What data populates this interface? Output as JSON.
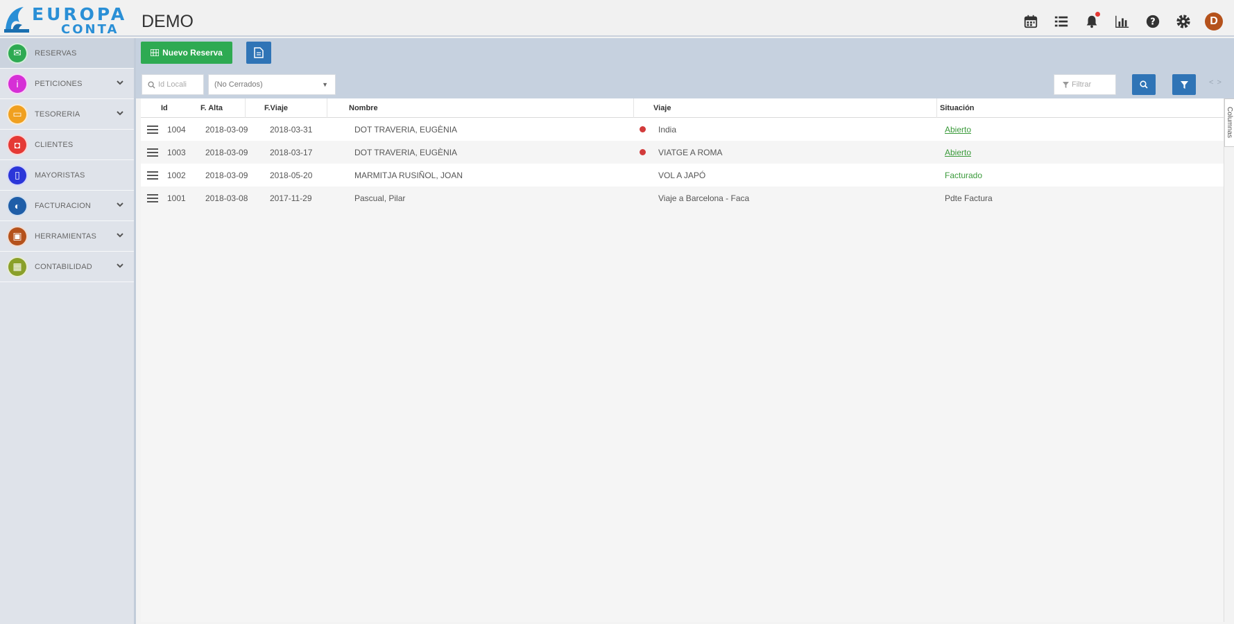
{
  "logo": {
    "line1": "EUROPA",
    "line2": "CONTA"
  },
  "header": {
    "title": "DEMO",
    "avatar_letter": "D",
    "icons": [
      "calendar-icon",
      "list-icon",
      "bell-icon",
      "bar-chart-icon",
      "help-icon",
      "settings-icon"
    ]
  },
  "sidebar": {
    "items": [
      {
        "label": "RESERVAS",
        "color": "#2eaa52",
        "icon": "envelope-icon",
        "has_chevron": false,
        "active": true
      },
      {
        "label": "PETICIONES",
        "color": "#d62fd6",
        "icon": "info-icon",
        "has_chevron": true,
        "active": false
      },
      {
        "label": "TESORERIA",
        "color": "#f0a020",
        "icon": "money-icon",
        "has_chevron": true,
        "active": false
      },
      {
        "label": "CLIENTES",
        "color": "#e53935",
        "icon": "shirt-icon",
        "has_chevron": false,
        "active": false
      },
      {
        "label": "MAYORISTAS",
        "color": "#2b36d9",
        "icon": "book-icon",
        "has_chevron": false,
        "active": false
      },
      {
        "label": "FACTURACION",
        "color": "#1f5ea8",
        "icon": "invoice-icon",
        "has_chevron": true,
        "active": false
      },
      {
        "label": "HERRAMIENTAS",
        "color": "#b5521c",
        "icon": "toolbox-icon",
        "has_chevron": true,
        "active": false
      },
      {
        "label": "CONTABILIDAD",
        "color": "#8aa02a",
        "icon": "calculator-icon",
        "has_chevron": true,
        "active": false
      }
    ]
  },
  "toolbar": {
    "new_label": "Nuevo Reserva"
  },
  "filters": {
    "search_placeholder": "Id Locali",
    "select_value": "(No Cerrados)",
    "filter_placeholder": "Filtrar",
    "collapse_label": "< >"
  },
  "grid": {
    "columns": {
      "id": "Id",
      "alta": "F. Alta",
      "viaje_fecha": "F.Viaje",
      "nombre": "Nombre",
      "viaje": "Viaje",
      "situacion": "Situación"
    },
    "rows": [
      {
        "id": "1004",
        "alta": "2018-03-09",
        "viaje_fecha": "2018-03-31",
        "nombre": "DOT TRAVERIA, EUGÈNIA",
        "flag": true,
        "viaje": "India",
        "situacion": "Abierto",
        "sit_style": "link"
      },
      {
        "id": "1003",
        "alta": "2018-03-09",
        "viaje_fecha": "2018-03-17",
        "nombre": "DOT TRAVERIA, EUGÈNIA",
        "flag": true,
        "viaje": "VIATGE A ROMA",
        "situacion": "Abierto",
        "sit_style": "link"
      },
      {
        "id": "1002",
        "alta": "2018-03-09",
        "viaje_fecha": "2018-05-20",
        "nombre": "MARMITJA RUSIÑOL, JOAN",
        "flag": false,
        "viaje": "VOL A JAPÓ",
        "situacion": "Facturado",
        "sit_style": "green"
      },
      {
        "id": "1001",
        "alta": "2018-03-08",
        "viaje_fecha": "2017-11-29",
        "nombre": "Pascual, Pilar",
        "flag": false,
        "viaje": "Viaje a Barcelona - Faca",
        "situacion": "Pdte Factura",
        "sit_style": "gray"
      }
    ]
  },
  "columns_tab": "Columnas"
}
